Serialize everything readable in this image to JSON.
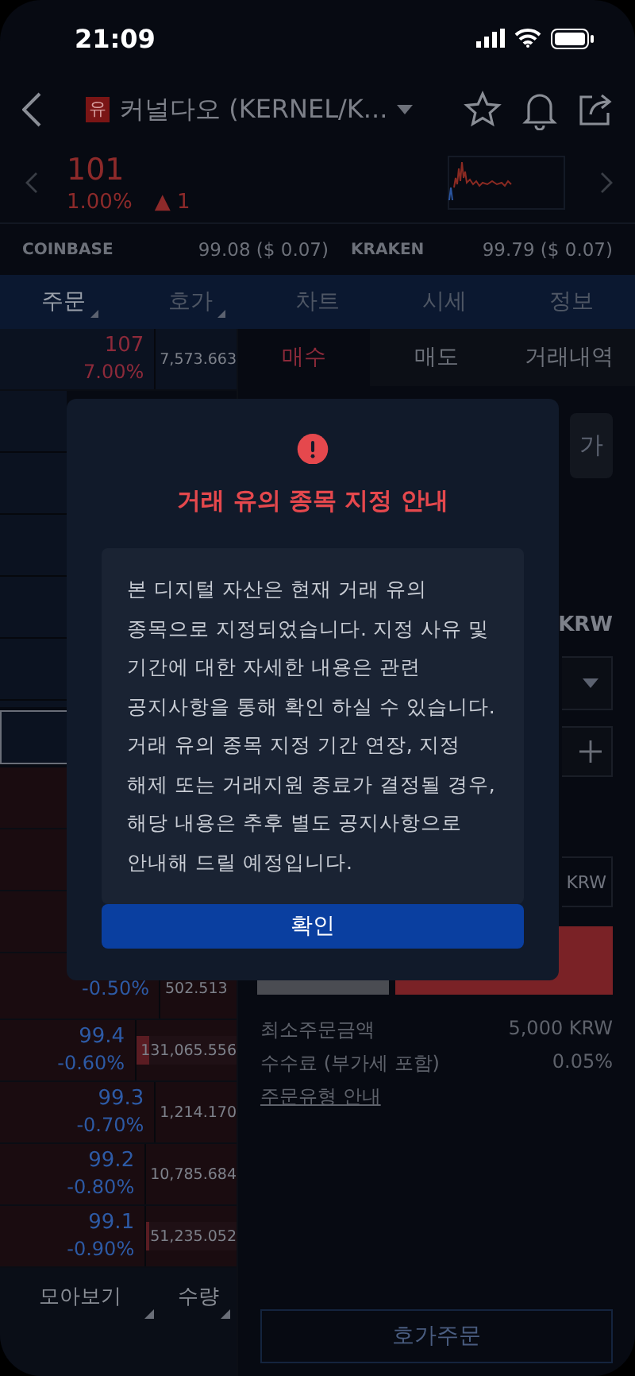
{
  "status_bar": {
    "time": "21:09"
  },
  "header": {
    "badge": "유",
    "title": "커널다오 (KERNEL/K..."
  },
  "ticker": {
    "price": "101",
    "change_rate": "1.00%",
    "change_arrow": "▲",
    "change": "1"
  },
  "exchanges": [
    {
      "name": "COINBASE",
      "price": "99.08 ($ 0.07)"
    },
    {
      "name": "KRAKEN",
      "price": "99.79 ($ 0.07)"
    }
  ],
  "tabs": [
    {
      "label": "주문",
      "selected": true,
      "has_menu": true
    },
    {
      "label": "호가",
      "selected": false,
      "has_menu": true
    },
    {
      "label": "차트",
      "selected": false,
      "has_menu": false
    },
    {
      "label": "시세",
      "selected": false,
      "has_menu": false
    },
    {
      "label": "정보",
      "selected": false,
      "has_menu": false
    }
  ],
  "orderbook": {
    "top_rows": [
      {
        "price": "107",
        "change": "7.00%",
        "volume": "7,573.663"
      }
    ],
    "bottom_rows": [
      {
        "change": "-0.50%",
        "volume": "502.513"
      },
      {
        "price": "99.4",
        "change": "-0.60%",
        "volume": "131,065.556",
        "level": 0.13
      },
      {
        "price": "99.3",
        "change": "-0.70%",
        "volume": "1,214.170"
      },
      {
        "price": "99.2",
        "change": "-0.80%",
        "volume": "10,785.684"
      },
      {
        "price": "99.1",
        "change": "-0.90%",
        "volume": "51,235.052",
        "level": 0.05
      }
    ],
    "footer": [
      "모아보기",
      "수량"
    ]
  },
  "order_tabs": [
    {
      "label": "매수",
      "selected": true
    },
    {
      "label": "매도",
      "selected": false
    },
    {
      "label": "거래내역",
      "selected": false
    }
  ],
  "order_form": {
    "chip": "가",
    "currency": "KRW",
    "total_unit": "KRW"
  },
  "info": [
    {
      "label": "최소주문금액",
      "value": "5,000 KRW"
    },
    {
      "label": "수수료 (부가세 포함)",
      "value": "0.05%"
    }
  ],
  "info_link": "주문유형 안내",
  "quote_order_button": "호가주문",
  "dialog": {
    "title": "거래 유의 종목 지정 안내",
    "message": "본 디지털 자산은 현재 거래 유의 종목으로 지정되었습니다. 지정 사유 및 기간에 대한 자세한 내용은 관련 공지사항을 통해 확인 하실 수 있습니다. 거래 유의 종목 지정 기간 연장, 지정 해제 또는 거래지원 종료가 결정될 경우, 해당 내용은 추후 별도 공지사항으로 안내해 드릴 예정입니다.",
    "confirm": "확인"
  }
}
